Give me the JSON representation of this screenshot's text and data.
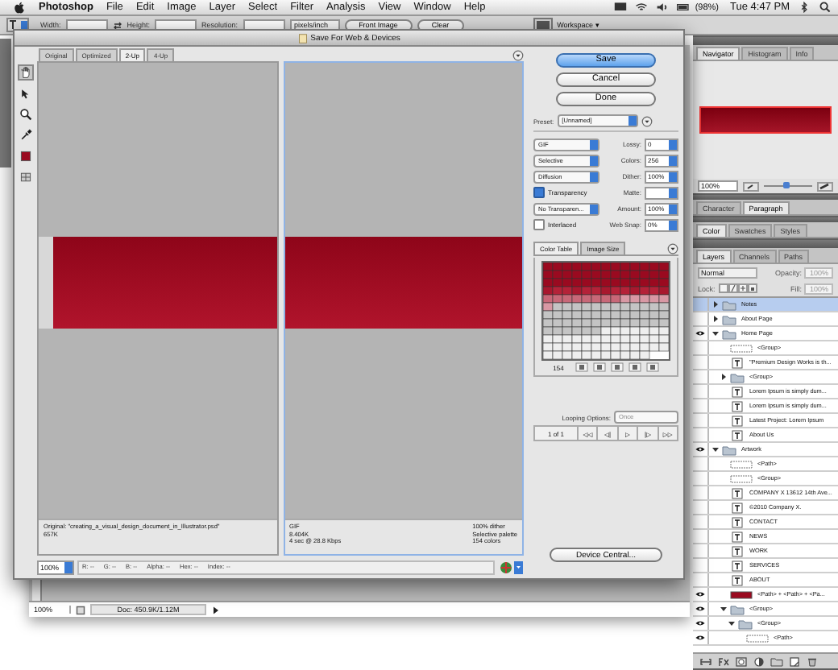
{
  "menu_bar": {
    "app": "Photoshop",
    "items": [
      "File",
      "Edit",
      "Image",
      "Layer",
      "Select",
      "Filter",
      "Analysis",
      "View",
      "Window",
      "Help"
    ],
    "battery": "(98%)",
    "clock": "Tue 4:47 PM"
  },
  "options_bar": {
    "fields": [
      "Width:",
      "Height:",
      "Resolution:"
    ],
    "units": "pixels/inch",
    "buttons": [
      "Front Image",
      "Clear"
    ],
    "workspace": "Workspace ▾"
  },
  "document": {
    "zoom": "100%",
    "doc_size": "Doc: 450.9K/1.12M"
  },
  "dialog": {
    "title": "Save For Web & Devices",
    "tabs": [
      {
        "label": "Original",
        "selected": false
      },
      {
        "label": "Optimized",
        "selected": false
      },
      {
        "label": "2-Up",
        "selected": true
      },
      {
        "label": "4-Up",
        "selected": false
      }
    ],
    "panes": [
      {
        "selected": false,
        "info_left": [
          "Original: \"creating_a_visual_design_document_in_Illustrator.psd\"",
          "657K"
        ]
      },
      {
        "selected": true,
        "info_left": [
          "GIF",
          "8.404K",
          "4 sec @ 28.8 Kbps"
        ],
        "info_right": [
          "100% dither",
          "Selective palette",
          "154 colors"
        ]
      }
    ],
    "zoom": "100%",
    "readout": [
      "R: --",
      "G: --",
      "B: --",
      "Alpha: --",
      "Hex: --",
      "Index: --"
    ],
    "buttons": [
      {
        "label": "Save",
        "default": true
      },
      {
        "label": "Cancel",
        "default": false
      },
      {
        "label": "Done",
        "default": false
      }
    ],
    "preset": {
      "label": "Preset:",
      "value": "[Unnamed]"
    },
    "settings": [
      {
        "kind": "select",
        "value": "GIF",
        "label": "Lossy:",
        "field": "0"
      },
      {
        "kind": "select",
        "value": "Selective",
        "label": "Colors:",
        "field": "256"
      },
      {
        "kind": "select",
        "value": "Diffusion",
        "label": "Dither:",
        "field": "100%"
      },
      {
        "kind": "checkbox",
        "value": "Transparency",
        "checked": true,
        "label": "Matte:"
      },
      {
        "kind": "select",
        "value": "No Transparen...",
        "label": "Amount:",
        "field": "100%"
      },
      {
        "kind": "checkbox",
        "value": "Interlaced",
        "checked": false,
        "label": "Web Snap:",
        "field": "0%"
      }
    ],
    "color_tabs": [
      {
        "label": "Color Table",
        "selected": true
      },
      {
        "label": "Image Size",
        "selected": false
      }
    ],
    "color_count": "154",
    "looping": {
      "label": "Looping Options:",
      "value": "Once"
    },
    "frame": "1 of 1",
    "frame_buttons": [
      "◁◁",
      "◁|",
      "▷",
      "|▷",
      "▷▷"
    ],
    "device_central": "Device Central..."
  },
  "panels": [
    {
      "tabs": [
        {
          "label": "Navigator",
          "selected": true
        },
        {
          "label": "Histogram",
          "selected": false
        },
        {
          "label": "Info",
          "selected": false
        }
      ]
    },
    {
      "tabs": [
        {
          "label": "Character",
          "selected": false
        },
        {
          "label": "Paragraph",
          "selected": true
        }
      ]
    },
    {
      "tabs": [
        {
          "label": "Color",
          "selected": true
        },
        {
          "label": "Swatches",
          "selected": false
        },
        {
          "label": "Styles",
          "selected": false
        }
      ]
    },
    {
      "tabs": [
        {
          "label": "Layers",
          "selected": true
        },
        {
          "label": "Channels",
          "selected": false
        },
        {
          "label": "Paths",
          "selected": false
        }
      ]
    }
  ],
  "navigator": {
    "zoom": "100%",
    "level": 0.45
  },
  "layers": {
    "mode": "Normal",
    "opacity_label": "Opacity:",
    "opacity": "100%",
    "lock_label": "Lock:",
    "fill_label": "Fill:",
    "fill": "100%",
    "items": [
      {
        "name": "Notes",
        "kind": "group",
        "visible": false,
        "selected": true,
        "expanded": false
      },
      {
        "name": "About Page",
        "kind": "group",
        "visible": false,
        "selected": false,
        "expanded": false
      },
      {
        "name": "Home Page",
        "kind": "group",
        "visible": true,
        "selected": false,
        "expanded": true,
        "children": [
          {
            "name": "<Group>",
            "kind": "shape",
            "visible": false,
            "selected": false
          },
          {
            "name": "\"Premium Design Works is th...",
            "kind": "text",
            "visible": false,
            "selected": false
          },
          {
            "name": "<Group>",
            "kind": "group",
            "visible": false,
            "selected": false,
            "expanded": false
          },
          {
            "name": "Lorem Ipsum is simply dum...",
            "kind": "text",
            "visible": false,
            "selected": false
          },
          {
            "name": "Lorem Ipsum is simply dum...",
            "kind": "text",
            "visible": false,
            "selected": false
          },
          {
            "name": "Latest Project: Lorem Ipsum",
            "kind": "text",
            "visible": false,
            "selected": false
          },
          {
            "name": "About Us",
            "kind": "text",
            "visible": false,
            "selected": false
          }
        ]
      },
      {
        "name": "Artwork",
        "kind": "group",
        "visible": true,
        "selected": false,
        "expanded": true,
        "children": [
          {
            "name": "<Path>",
            "kind": "shape",
            "visible": false,
            "selected": false
          },
          {
            "name": "<Group>",
            "kind": "shape",
            "visible": false,
            "selected": false
          },
          {
            "name": "COMPANY X 13612 14th Ave...",
            "kind": "text",
            "visible": false,
            "selected": false
          },
          {
            "name": "©2010 Company X.",
            "kind": "text",
            "visible": false,
            "selected": false
          },
          {
            "name": "CONTACT",
            "kind": "text",
            "visible": false,
            "selected": false
          },
          {
            "name": "NEWS",
            "kind": "text",
            "visible": false,
            "selected": false
          },
          {
            "name": "WORK",
            "kind": "text",
            "visible": false,
            "selected": false
          },
          {
            "name": "SERVICES",
            "kind": "text",
            "visible": false,
            "selected": false
          },
          {
            "name": "ABOUT",
            "kind": "text",
            "visible": false,
            "selected": false
          },
          {
            "name": "<Path> + <Path> + <Pa...",
            "kind": "art",
            "visible": true,
            "selected": false
          },
          {
            "name": "<Group>",
            "kind": "group",
            "visible": true,
            "selected": false,
            "expanded": true,
            "children": [
              {
                "name": "<Group>",
                "kind": "group",
                "visible": true,
                "selected": false,
                "expanded": true,
                "children": [
                  {
                    "name": "<Path>",
                    "kind": "shape",
                    "visible": true,
                    "selected": false
                  }
                ]
              }
            ]
          }
        ]
      }
    ]
  }
}
